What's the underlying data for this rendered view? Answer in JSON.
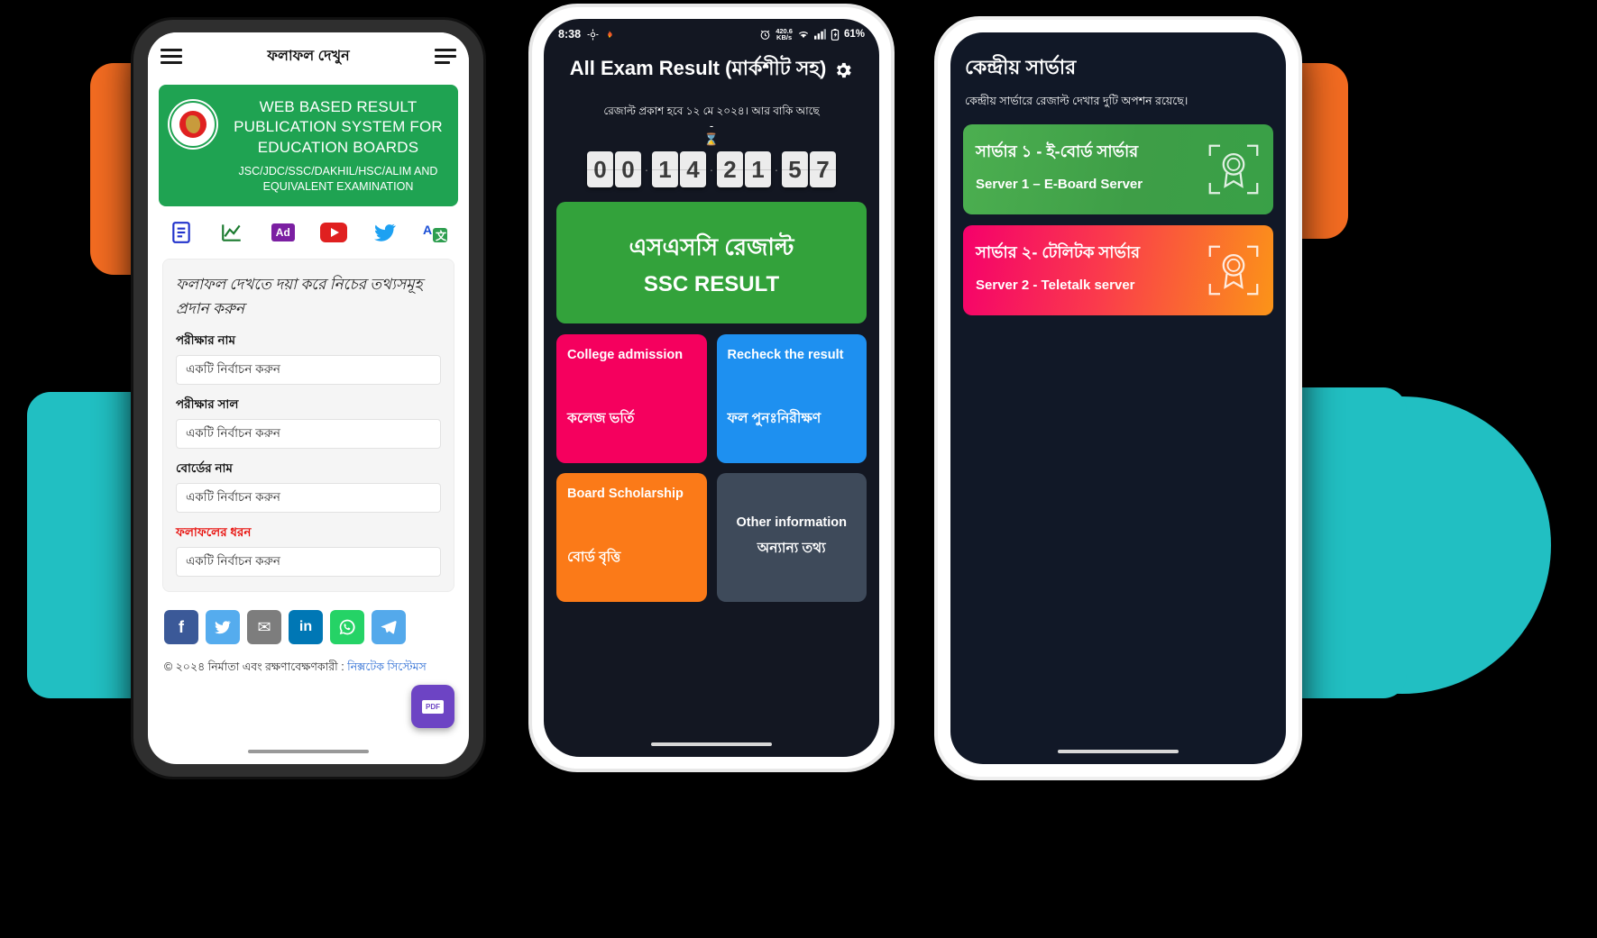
{
  "phone1": {
    "appbar": {
      "title": "ফলাফল দেখুন",
      "menu_icon": "hamburger-menu-icon",
      "menu_right_icon": "hamburger-menu-right-icon"
    },
    "banner": {
      "title": "WEB BASED RESULT PUBLICATION SYSTEM FOR EDUCATION BOARDS",
      "subtitle": "JSC/JDC/SSC/DAKHIL/HSC/ALIM AND EQUIVALENT EXAMINATION",
      "logo_icon": "bangladesh-govt-emblem-icon",
      "bg_color": "#1FA352"
    },
    "quicklinks": [
      {
        "name": "result-list-icon",
        "label": ""
      },
      {
        "name": "statistics-chart-icon",
        "label": ""
      },
      {
        "name": "ad-icon",
        "label": "Ad"
      },
      {
        "name": "youtube-icon",
        "label": ""
      },
      {
        "name": "twitter-icon",
        "label": ""
      },
      {
        "name": "translate-icon",
        "label": ""
      }
    ],
    "form": {
      "lead": "ফলাফল দেখতে দয়া করে নিচের তথ্যসমূহ প্রদান করুন",
      "fields": [
        {
          "label": "পরীক্ষার নাম",
          "value": "একটি নির্বাচন করুন",
          "required": false
        },
        {
          "label": "পরীক্ষার সাল",
          "value": "একটি নির্বাচন করুন",
          "required": false
        },
        {
          "label": "বোর্ডের নাম",
          "value": "একটি নির্বাচন করুন",
          "required": false
        },
        {
          "label": "ফলাফলের ধরন",
          "value": "একটি নির্বাচন করুন",
          "required": true
        }
      ],
      "required_color": "#e8130f"
    },
    "social": [
      {
        "name": "facebook-share-button",
        "glyph": "f",
        "color": "#3b5998"
      },
      {
        "name": "twitter-share-button",
        "glyph": "",
        "color": "#55acee"
      },
      {
        "name": "email-share-button",
        "glyph": "✉",
        "color": "#7d7d7d"
      },
      {
        "name": "linkedin-share-button",
        "glyph": "in",
        "color": "#0077b5"
      },
      {
        "name": "whatsapp-share-button",
        "glyph": "",
        "color": "#25d366"
      },
      {
        "name": "telegram-share-button",
        "glyph": "➤",
        "color": "#54a9eb"
      }
    ],
    "footer": {
      "text": "© ২০২৪ নির্মাতা এবং রক্ষণাবেক্ষণকারী : ",
      "link": "নিক্সটেক সিস্টেমস"
    },
    "fab": {
      "name": "pdf-download-button",
      "label": "PDF",
      "color": "#6D44C4"
    }
  },
  "phone2": {
    "status": {
      "time": "8:38",
      "alarm_icon": "alarm-clock-icon",
      "net_speed": "420.6",
      "net_speed_unit": "KB/s",
      "wifi_icon": "wifi-icon",
      "signal_icon": "cellular-signal-icon",
      "battery_icon": "battery-icon",
      "battery": "61%"
    },
    "title": "All Exam Result (মার্কশীট সহ)",
    "settings_icon": "gear-icon",
    "countdown": {
      "notice": "রেজাল্ট প্রকাশ হবে ১২ মে ২০২৪। আর বাকি আছে",
      "dash": "-",
      "hourglass": "⌛",
      "digits": [
        "0",
        "0",
        "1",
        "4",
        "2",
        "1",
        "5",
        "7"
      ]
    },
    "hero": {
      "bn": "এসএসসি রেজাল্ট",
      "en": "SSC RESULT",
      "color": "#33A23B"
    },
    "tiles": [
      {
        "en": "College admission",
        "bn": "কলেজ ভর্তি",
        "color": "#F5005E",
        "name": "tile-college-admission"
      },
      {
        "en": "Recheck the result",
        "bn": "ফল পুনঃনিরীক্ষণ",
        "color": "#1E90F0",
        "name": "tile-recheck-result"
      },
      {
        "en": "Board Scholarship",
        "bn": "বোর্ড বৃত্তি",
        "color": "#FB7A18",
        "name": "tile-board-scholarship"
      },
      {
        "en": "Other information",
        "bn": "অন্যান্য তথ্য",
        "color": "#3E4A5A",
        "name": "tile-other-information"
      }
    ]
  },
  "phone3": {
    "title": "কেন্দ্রীয় সার্ভার",
    "subtitle": "কেন্দ্রীয় সার্ভারে রেজাল্ট দেখার দুটি অপশন রয়েছে।",
    "servers": [
      {
        "bn": "সার্ভার ১ - ই-বোর্ড সার্ভার",
        "en": "Server 1 – E-Board Server",
        "style": "green",
        "badge_icon": "award-badge-icon",
        "name": "server-card-eboard"
      },
      {
        "bn": "সার্ভার ২- টেলিটক সার্ভার",
        "en": "Server 2 - Teletalk server",
        "style": "pinkor",
        "badge_icon": "award-badge-icon",
        "name": "server-card-teletalk"
      }
    ]
  }
}
